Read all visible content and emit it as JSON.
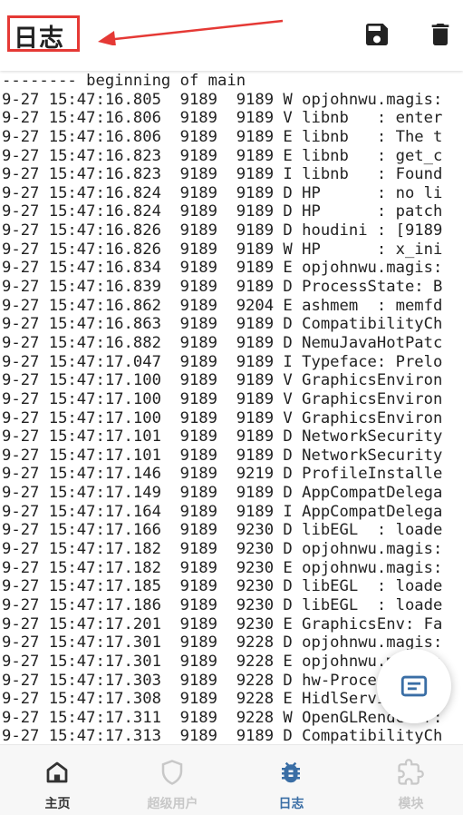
{
  "header": {
    "title": "日志"
  },
  "log": {
    "lines": [
      "-------- beginning of main",
      "9-27 15:47:16.805  9189  9189 W opjohnwu.magis:",
      "9-27 15:47:16.806  9189  9189 V libnb   : enter",
      "9-27 15:47:16.806  9189  9189 E libnb   : The t",
      "9-27 15:47:16.823  9189  9189 E libnb   : get_c",
      "9-27 15:47:16.823  9189  9189 I libnb   : Found",
      "9-27 15:47:16.824  9189  9189 D HP      : no li",
      "9-27 15:47:16.824  9189  9189 D HP      : patch",
      "9-27 15:47:16.826  9189  9189 D houdini : [9189",
      "9-27 15:47:16.826  9189  9189 W HP      : x_ini",
      "9-27 15:47:16.834  9189  9189 E opjohnwu.magis:",
      "9-27 15:47:16.839  9189  9189 D ProcessState: B",
      "9-27 15:47:16.862  9189  9204 E ashmem  : memfd",
      "9-27 15:47:16.863  9189  9189 D CompatibilityCh",
      "9-27 15:47:16.882  9189  9189 D NemuJavaHotPatc",
      "9-27 15:47:17.047  9189  9189 I Typeface: Prelo",
      "9-27 15:47:17.100  9189  9189 V GraphicsEnviron",
      "9-27 15:47:17.100  9189  9189 V GraphicsEnviron",
      "9-27 15:47:17.100  9189  9189 V GraphicsEnviron",
      "9-27 15:47:17.101  9189  9189 D NetworkSecurity",
      "9-27 15:47:17.101  9189  9189 D NetworkSecurity",
      "9-27 15:47:17.146  9189  9219 D ProfileInstalle",
      "9-27 15:47:17.149  9189  9189 D AppCompatDelega",
      "9-27 15:47:17.164  9189  9189 I AppCompatDelega",
      "9-27 15:47:17.166  9189  9230 D libEGL  : loade",
      "9-27 15:47:17.182  9189  9230 D opjohnwu.magis:",
      "9-27 15:47:17.182  9189  9230 E opjohnwu.magis:",
      "9-27 15:47:17.185  9189  9230 D libEGL  : loade",
      "9-27 15:47:17.186  9189  9230 D libEGL  : loade",
      "9-27 15:47:17.201  9189  9230 E GraphicsEnv: Fa",
      "9-27 15:47:17.301  9189  9228 D opjohnwu.magis:",
      "9-27 15:47:17.301  9189  9228 E opjohnwu.magis:",
      "9-27 15:47:17.303  9189  9228 D hw-ProcessState",
      "9-27 15:47:17.308  9189  9228 E HidlServiceMana",
      "9-27 15:47:17.311  9189  9228 W OpenGLRenderer:",
      "9-27 15:47:17.313  9189  9189 D CompatibilityCh"
    ]
  },
  "nav": {
    "items": [
      {
        "label": "主页",
        "icon": "home-icon",
        "color": "#333333"
      },
      {
        "label": "超级用户",
        "icon": "shield-icon",
        "color": "#c8c8c8"
      },
      {
        "label": "日志",
        "icon": "bug-icon",
        "color": "#3a6ea5"
      },
      {
        "label": "模块",
        "icon": "puzzle-icon",
        "color": "#c8c8c8"
      }
    ]
  },
  "colors": {
    "accent": "#3a6ea5",
    "annotation": "#e53935"
  }
}
